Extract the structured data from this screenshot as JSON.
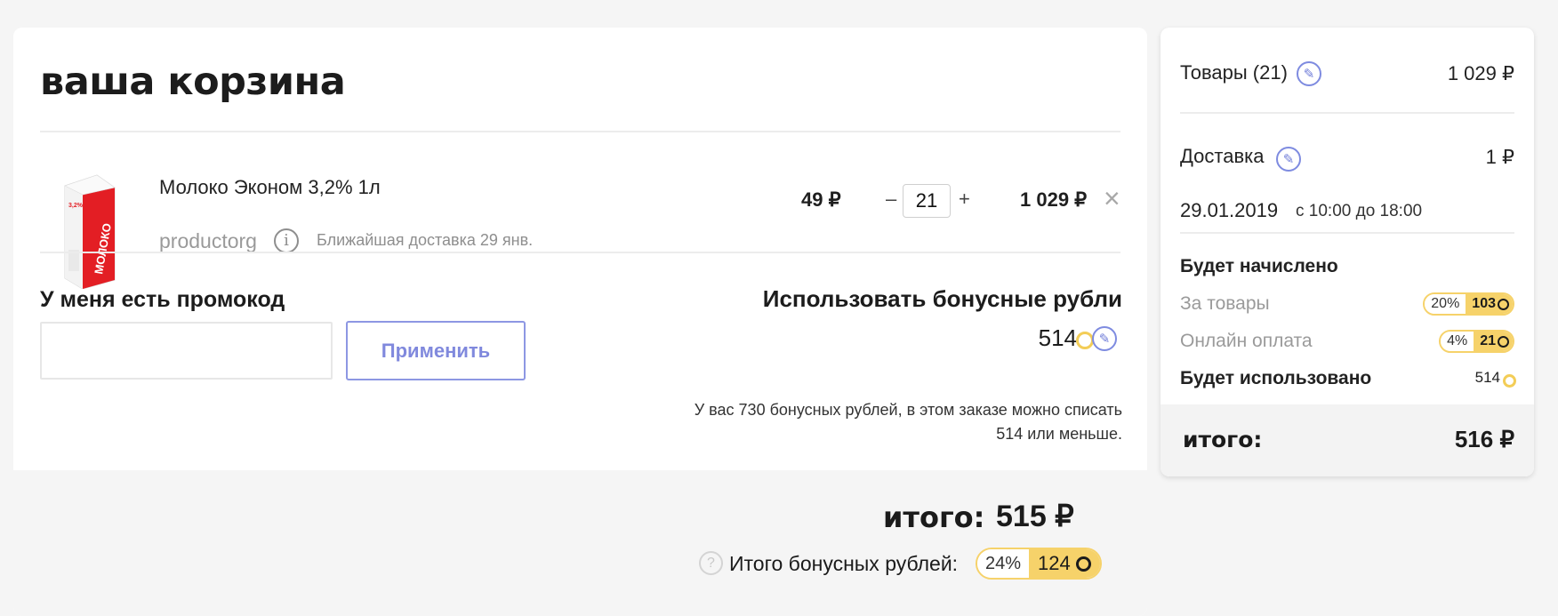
{
  "cart": {
    "title": "ваша корзина",
    "item": {
      "name": "Молоко Эконом 3,2% 1л",
      "seller": "productorg",
      "delivery": "Ближайшая доставка 29 янв.",
      "price": "49 ₽",
      "quantity": "21",
      "total": "1 029 ₽",
      "minus": "–",
      "plus": "+",
      "remove": "×",
      "package_text": "МОЛОКО",
      "package_fat": "3,2%"
    },
    "promo": {
      "label": "У меня есть промокод",
      "placeholder": "",
      "apply_label": "Применить"
    },
    "bonus": {
      "title": "Использовать бонусные рубли",
      "amount": "514",
      "note": "У вас 730 бонусных рублей, в этом заказе можно списать 514 или меньше."
    },
    "totals": {
      "label": "итого:",
      "value": "515 ₽",
      "bonus_label": "Итого бонусных рублей:",
      "bonus_percent": "24%",
      "bonus_value": "124",
      "help": "?"
    }
  },
  "summary": {
    "goods_label": "Товары (21)",
    "goods_value": "1 029 ₽",
    "delivery_label": "Доставка",
    "delivery_value": "1 ₽",
    "date": "29.01.2019",
    "time": "с 10:00 до 18:00",
    "accrue_title": "Будет начислено",
    "for_goods_label": "За товары",
    "for_goods_percent": "20%",
    "for_goods_value": "103",
    "online_label": "Онлайн оплата",
    "online_percent": "4%",
    "online_value": "21",
    "used_label": "Будет использовано",
    "used_value": "514",
    "total_label": "итого:",
    "total_value": "516 ₽"
  },
  "colors": {
    "accent": "#8d97e3",
    "bonus_yellow": "#f6d26a",
    "product_red": "#e31e24"
  },
  "icons": [
    "info-icon",
    "edit-icon",
    "coin-icon",
    "close-icon",
    "question-icon"
  ]
}
